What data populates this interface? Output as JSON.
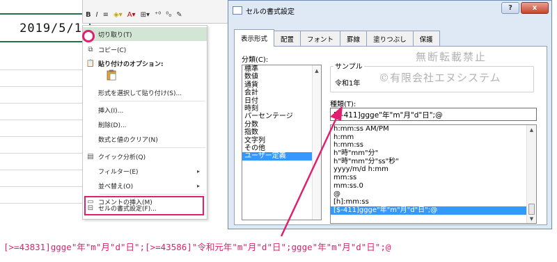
{
  "cell": {
    "value": "2019/5/1"
  },
  "mini_toolbar": {
    "bold": "B",
    "italic": "I"
  },
  "context_menu": {
    "items": [
      {
        "icon": "scissors-icon",
        "label": "切り取り(T)",
        "highlighted": true
      },
      {
        "icon": "copy-icon",
        "label": "コピー(C)"
      },
      {
        "icon": "paste-icon",
        "label": "貼り付けのオプション:"
      },
      {
        "icon": "",
        "label": "形式を選択して貼り付け(S)..."
      },
      {
        "icon": "",
        "label": "挿入(I)..."
      },
      {
        "icon": "",
        "label": "削除(D)..."
      },
      {
        "icon": "",
        "label": "数式と値のクリア(N)"
      },
      {
        "icon": "quick-analysis-icon",
        "label": "クイック分析(Q)"
      },
      {
        "icon": "",
        "label": "フィルター(E)",
        "submenu": true
      },
      {
        "icon": "",
        "label": "並べ替え(O)",
        "submenu": true
      },
      {
        "icon": "comment-icon",
        "label": "コメントの挿入(M)"
      },
      {
        "icon": "format-cells-icon",
        "label": "セルの書式設定(F)..."
      }
    ]
  },
  "dialog": {
    "title": "セルの書式設定",
    "help_button": "?",
    "close_button": "x",
    "tabs": [
      "表示形式",
      "配置",
      "フォント",
      "罫線",
      "塗りつぶし",
      "保護"
    ],
    "active_tab": 0,
    "category_label": "分類(C):",
    "categories": [
      "標準",
      "数値",
      "通貨",
      "会計",
      "日付",
      "時刻",
      "パーセンテージ",
      "分数",
      "指数",
      "文字列",
      "その他",
      "ユーザー定義"
    ],
    "selected_category": 11,
    "sample_label": "サンプル",
    "sample_value": "令和1年",
    "type_label": "種類(T):",
    "type_value": "[$-411]ggge\"年\"m\"月\"d\"日\";@",
    "type_list": [
      "h:mm:ss AM/PM",
      "h:mm",
      "h:mm:ss",
      "h\"時\"mm\"分\"",
      "h\"時\"mm\"分\"ss\"秒\"",
      "yyyy/m/d h:mm",
      "mm:ss",
      "mm:ss.0",
      "@",
      "[h]:mm:ss",
      "[$-411]ggge\"年\"m\"月\"d\"日\";@"
    ],
    "selected_type": 10
  },
  "watermark": {
    "line1": "無断転載禁止",
    "line2": "©有限会社エヌシステム"
  },
  "annotation": {
    "formula": "[>=43831]ggge\"年\"m\"月\"d\"日\";[>=43586]\"令和元年\"m\"月\"d\"日\";ggge\"年\"m\"月\"d\"日\";@"
  },
  "colors": {
    "accent": "#e0206e",
    "selection": "#3399ff",
    "excel_green": "#217346"
  }
}
